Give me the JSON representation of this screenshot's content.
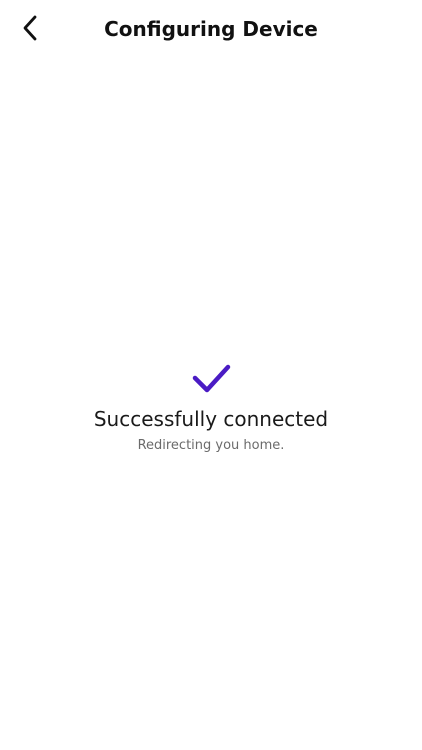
{
  "header": {
    "title": "Configuring Device",
    "back_icon": "chevron-left-icon"
  },
  "status": {
    "icon": "checkmark-icon",
    "icon_color": "#4A1BC4",
    "title": "Successfully connected",
    "subtitle": "Redirecting you home."
  }
}
